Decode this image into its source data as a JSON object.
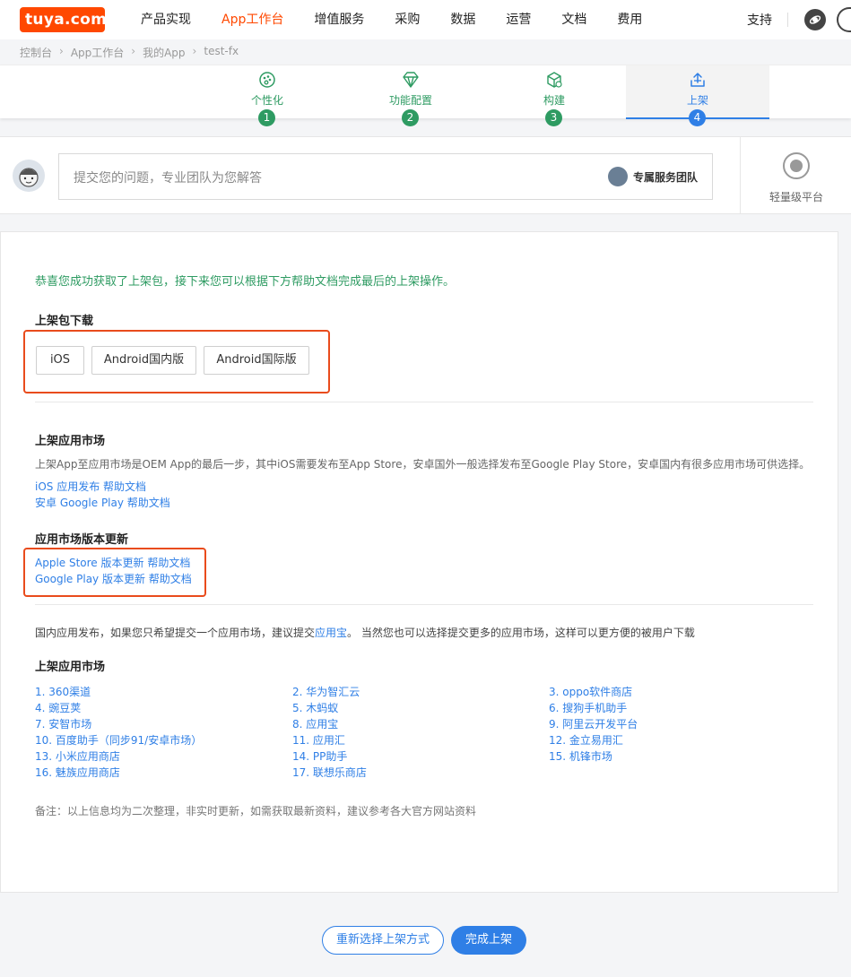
{
  "nav": {
    "logo": "tuya.com",
    "items": [
      "产品实现",
      "App工作台",
      "增值服务",
      "采购",
      "数据",
      "运营",
      "文档",
      "费用"
    ],
    "active_index": 1,
    "support": "支持"
  },
  "breadcrumb": [
    "控制台",
    "App工作台",
    "我的App",
    "test-fx"
  ],
  "steps": [
    {
      "label": "个性化",
      "num": "1",
      "icon": "palette-icon"
    },
    {
      "label": "功能配置",
      "num": "2",
      "icon": "diamond-icon"
    },
    {
      "label": "构建",
      "num": "3",
      "icon": "cube-icon"
    },
    {
      "label": "上架",
      "num": "4",
      "icon": "upload-tray-icon"
    }
  ],
  "active_step": 4,
  "question": {
    "placeholder": "提交您的问题，专业团队为您解答",
    "team_label": "专属服务团队"
  },
  "platform_label": "轻量级平台",
  "main": {
    "congrats": "恭喜您成功获取了上架包，接下来您可以根据下方帮助文档完成最后的上架操作。",
    "download_title": "上架包下载",
    "download_buttons": [
      "iOS",
      "Android国内版",
      "Android国际版"
    ],
    "market_title": "上架应用市场",
    "market_desc": "上架App至应用市场是OEM App的最后一步，其中iOS需要发布至App Store，安卓国外一般选择发布至Google Play Store，安卓国内有很多应用市场可供选择。",
    "help_links": [
      "iOS 应用发布 帮助文档",
      "安卓 Google Play 帮助文档"
    ],
    "update_title": "应用市场版本更新",
    "update_links": [
      "Apple Store 版本更新 帮助文档",
      "Google Play 版本更新 帮助文档"
    ],
    "domestic_text_pre": "国内应用发布，如果您只希望提交一个应用市场，建议提交",
    "domestic_link": "应用宝",
    "domestic_text_post": "。 当然您也可以选择提交更多的应用市场，这样可以更方便的被用户下载",
    "markets_title": "上架应用市场",
    "markets": [
      "1. 360渠道",
      "2. 华为智汇云",
      "3. oppo软件商店",
      "4. 豌豆荚",
      "5. 木蚂蚁",
      "6. 搜狗手机助手",
      "7. 安智市场",
      "8. 应用宝",
      "9. 阿里云开发平台",
      "10. 百度助手（同步91/安卓市场）",
      "11. 应用汇",
      "12. 金立易用汇",
      "13. 小米应用商店",
      "14. PP助手",
      "15. 机锋市场",
      "16. 魅族应用商店",
      "17. 联想乐商店"
    ],
    "note": "备注：以上信息均为二次整理，非实时更新，如需获取最新资料，建议参考各大官方网站资料"
  },
  "footer": {
    "reselect": "重新选择上架方式",
    "done": "完成上架"
  },
  "colors": {
    "brand": "#ff4800",
    "green": "#2e9b62",
    "blue": "#2f7fe6",
    "highlight_red": "#e94b1c"
  }
}
